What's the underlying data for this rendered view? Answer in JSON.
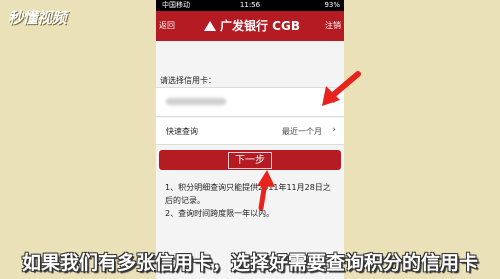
{
  "watermark": "秒懂视频",
  "status_bar": {
    "carrier": "中国移动",
    "time": "11:56",
    "battery": "93%"
  },
  "header": {
    "back_label": "返回",
    "title": "广发银行 CGB",
    "logout_label": "注销",
    "color": "#b41b23"
  },
  "form": {
    "select_label": "请选择信用卡：",
    "card_chevron": "›",
    "query_label": "快速查询",
    "query_value": "最近一个月",
    "query_chevron": "›",
    "next_button": "下一步"
  },
  "notes": [
    "1、积分明细查询只能提供2011年11月28日之后的记录。",
    "2、查询时间跨度限一年以内。"
  ],
  "caption": "如果我们有多张信用卡，选择好需要查询积分的信用卡",
  "annotation_color": "#e8231c"
}
